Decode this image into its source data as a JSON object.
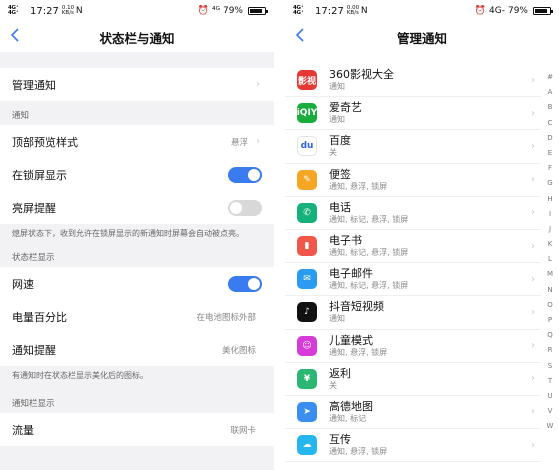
{
  "colors": {
    "accent": "#3a7bf0",
    "toggle_off": "#d8d8d8"
  },
  "status_bar": {
    "left": {
      "network": "4G⁺ 4G⁺",
      "time": "17:27",
      "speed_left": "0.10 KB/s",
      "speed_right": "0.00 KB/s",
      "nfc": "N"
    },
    "right": {
      "alarm": "⏰",
      "signal_left": "⁴ᴳ",
      "signal_right": "4G-",
      "battery_percent": "79%",
      "battery_level": 0.79
    }
  },
  "left_screen": {
    "title": "状态栏与通知",
    "manage_notifications": "管理通知",
    "section_notifications": "通知",
    "top_preview_label": "顶部预览样式",
    "top_preview_value": "悬浮",
    "lockscreen_label": "在锁屏显示",
    "lockscreen_on": true,
    "wake_label": "亮屏提醒",
    "wake_on": false,
    "wake_note": "熄屏状态下，收到允许在锁屏显示的新通知时屏幕会自动被点亮。",
    "section_statusbar": "状态栏显示",
    "netspeed_label": "网速",
    "netspeed_on": true,
    "battery_label": "电量百分比",
    "battery_value": "在电池图标外部",
    "notify_label": "通知提醒",
    "notify_value": "美化图标",
    "notify_note": "有通知时在状态栏显示美化后的图标。",
    "section_notifbar": "通知栏显示",
    "traffic_label": "流量",
    "traffic_value": "联网卡"
  },
  "right_screen": {
    "title": "管理通知",
    "apps": [
      {
        "name": "360影视大全",
        "sub": "通知",
        "icon": "360-video-icon",
        "glyph": "影视",
        "color": "#e53935"
      },
      {
        "name": "爱奇艺",
        "sub": "通知",
        "icon": "iqiyi-icon",
        "glyph": "iQIY",
        "color": "#1aac3c"
      },
      {
        "name": "百度",
        "sub": "关",
        "icon": "baidu-icon",
        "glyph": "du",
        "color": "#ffffff"
      },
      {
        "name": "便签",
        "sub": "通知, 悬浮, 锁屏",
        "icon": "notes-icon",
        "glyph": "✎",
        "color": "#f5a623"
      },
      {
        "name": "电话",
        "sub": "通知, 标记, 悬浮, 锁屏",
        "icon": "phone-icon",
        "glyph": "✆",
        "color": "#16b07a"
      },
      {
        "name": "电子书",
        "sub": "通知, 标记, 悬浮, 锁屏",
        "icon": "ebook-icon",
        "glyph": "▮",
        "color": "#f0564a"
      },
      {
        "name": "电子邮件",
        "sub": "通知, 标记, 悬浮, 锁屏",
        "icon": "email-icon",
        "glyph": "✉",
        "color": "#2a9bf0"
      },
      {
        "name": "抖音短视频",
        "sub": "通知",
        "icon": "douyin-icon",
        "glyph": "♪",
        "color": "#111111"
      },
      {
        "name": "儿童模式",
        "sub": "通知, 悬浮, 锁屏",
        "icon": "kids-mode-icon",
        "glyph": "☺",
        "color": "#d63bd8"
      },
      {
        "name": "返利",
        "sub": "关",
        "icon": "rebate-icon",
        "glyph": "¥",
        "color": "#2bb673"
      },
      {
        "name": "高德地图",
        "sub": "通知, 标记",
        "icon": "amap-icon",
        "glyph": "➤",
        "color": "#3a8ef0"
      },
      {
        "name": "互传",
        "sub": "通知, 悬浮, 锁屏",
        "icon": "transfer-icon",
        "glyph": "☁",
        "color": "#25b6f0"
      }
    ],
    "index_letters": [
      "#",
      "A",
      "B",
      "C",
      "D",
      "E",
      "F",
      "G",
      "H",
      "I",
      "J",
      "K",
      "L",
      "M",
      "N",
      "O",
      "P",
      "Q",
      "R",
      "S",
      "T",
      "U",
      "V",
      "W"
    ]
  }
}
